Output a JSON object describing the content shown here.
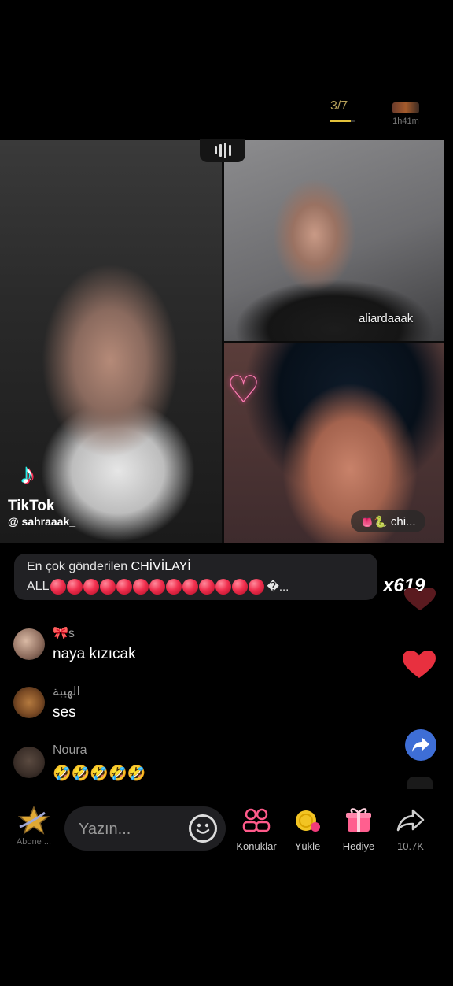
{
  "top": {
    "progress_text": "3/7",
    "progress_fraction": 0.8,
    "timer": "1h41m"
  },
  "stage": {
    "guest1_name": "aliardaaak",
    "guest2_chip_emojis": "👅🐍",
    "guest2_chip_text": "chi..."
  },
  "watermark": {
    "brand": "TikTok",
    "user": "@ sahraaak_"
  },
  "gift_banner": {
    "line1_prefix": "En çok gönderilen",
    "line1_highlight": "CHİVİLAYİ",
    "line2_prefix": "ALL",
    "dot_count": 13,
    "line2_suffix": "�...",
    "count": "x619"
  },
  "comments": [
    {
      "user": "🎀s",
      "text": "naya kızıcak"
    },
    {
      "user": "الهيبة",
      "text": "ses"
    },
    {
      "user": "Noura",
      "text": "🤣🤣🤣🤣🤣"
    }
  ],
  "bottom_bar": {
    "subscribe_label": "Abone ...",
    "input_placeholder": "Yazın...",
    "guests_label": "Konuklar",
    "recharge_label": "Yükle",
    "gift_label": "Hediye",
    "share_count": "10.7K"
  },
  "colors": {
    "heart": "#e8303f",
    "share_button": "#3e6ed6",
    "accent_pink": "#ff7eb6",
    "progress": "#e3c23b"
  },
  "icons": [
    "audio-level-icon",
    "heart-icon",
    "share-icon",
    "star-icon",
    "emoji-icon",
    "guests-icon",
    "coin-icon",
    "gift-icon"
  ]
}
